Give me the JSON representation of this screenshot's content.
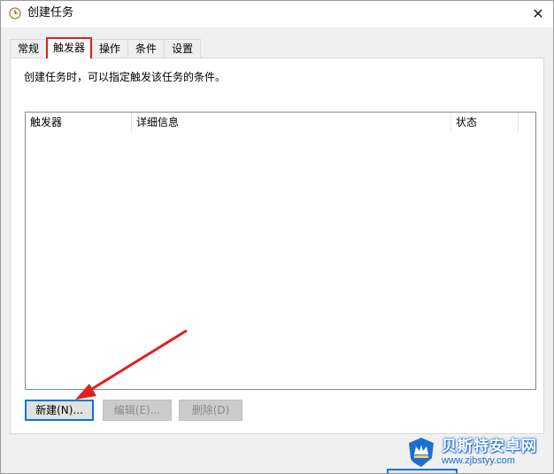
{
  "window": {
    "title": "创建任务",
    "close_glyph": "✕"
  },
  "tabs": [
    {
      "label": "常规",
      "active": false
    },
    {
      "label": "触发器",
      "active": true
    },
    {
      "label": "操作",
      "active": false
    },
    {
      "label": "条件",
      "active": false
    },
    {
      "label": "设置",
      "active": false
    }
  ],
  "panel": {
    "description": "创建任务时，可以指定触发该任务的条件。",
    "list": {
      "columns": [
        "触发器",
        "详细信息",
        "状态"
      ],
      "rows": []
    },
    "buttons": {
      "new_label": "新建(N)...",
      "edit_label": "编辑(E)...",
      "delete_label": "删除(D)"
    }
  },
  "watermark": {
    "name": "贝斯特安卓网",
    "url": "www.zjbstyy.com"
  },
  "colors": {
    "highlight_red": "#e02020",
    "accent_blue": "#0078d7",
    "watermark_blue": "#1a6fd0"
  },
  "icons": {
    "title_icon": "clock-icon",
    "close_icon": "close-icon",
    "watermark_logo": "crown-shield-icon"
  }
}
